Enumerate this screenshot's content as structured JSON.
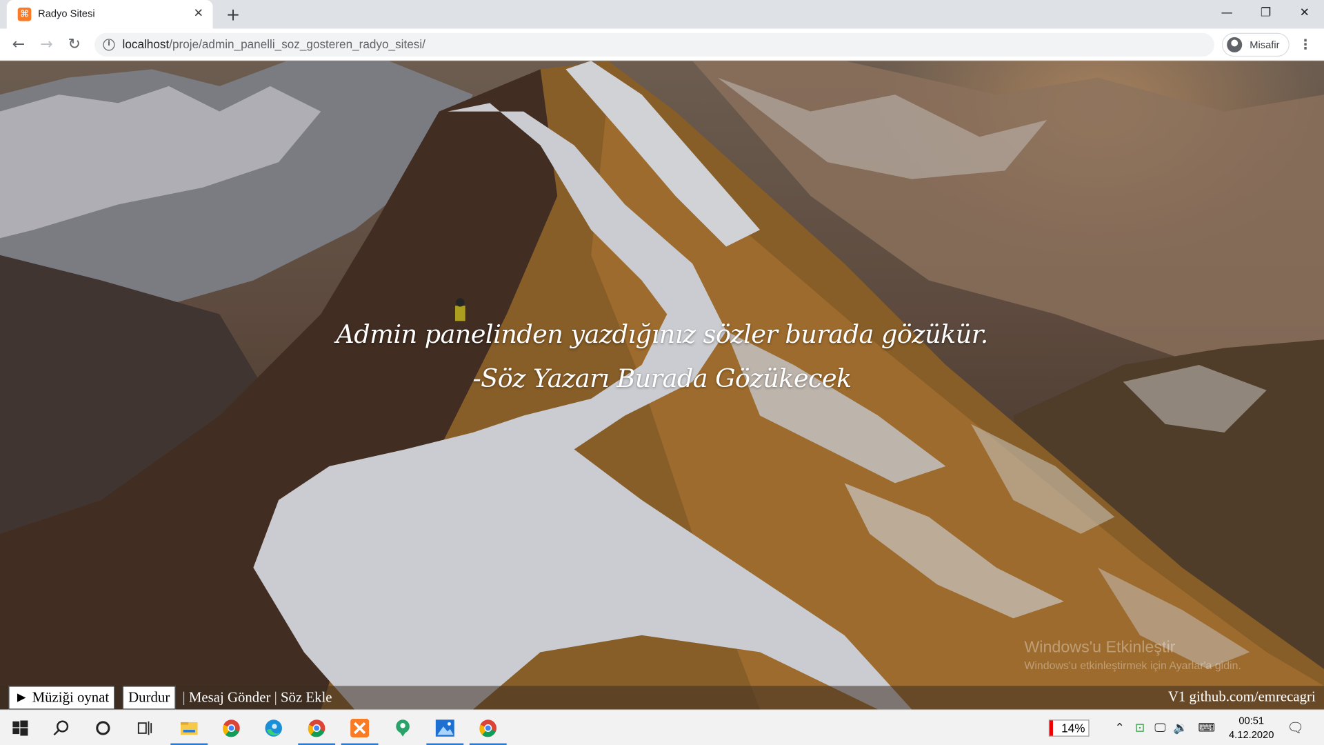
{
  "browser": {
    "tab_title": "Radyo Sitesi",
    "url_host": "localhost",
    "url_path": "/proje/admin_panelli_soz_gosteren_radyo_sitesi/",
    "profile_name": "Misafir"
  },
  "page": {
    "quote": "Admin panelinden yazdığınız sözler burada gözükür.",
    "author": "-Söz Yazarı Burada Gözükecek",
    "play_button": "► Müziği oynat",
    "stop_button": "Durdur",
    "link_message": "Mesaj Gönder",
    "link_add_quote": "Söz Ekle",
    "link_separator": "|",
    "version": "V1 github.com/emrecagri"
  },
  "watermark": {
    "title": "Windows'u Etkinleştir",
    "subtitle": "Windows'u etkinleştirmek için Ayarlar'a gidin."
  },
  "taskbar": {
    "battery_percent": "14%",
    "time": "00:51",
    "date": "4.12.2020",
    "pinned": [
      "start-icon",
      "search-icon",
      "cortana-icon",
      "task-view-icon",
      "file-explorer-icon",
      "chrome-icon",
      "edge-icon",
      "chrome-icon",
      "xampp-icon",
      "maps-icon",
      "photos-icon",
      "chrome-icon"
    ]
  },
  "colors": {
    "tab_strip": "#dee1e6",
    "xampp_orange": "#fb7a24",
    "taskbar_active": "#2a7bd4"
  }
}
